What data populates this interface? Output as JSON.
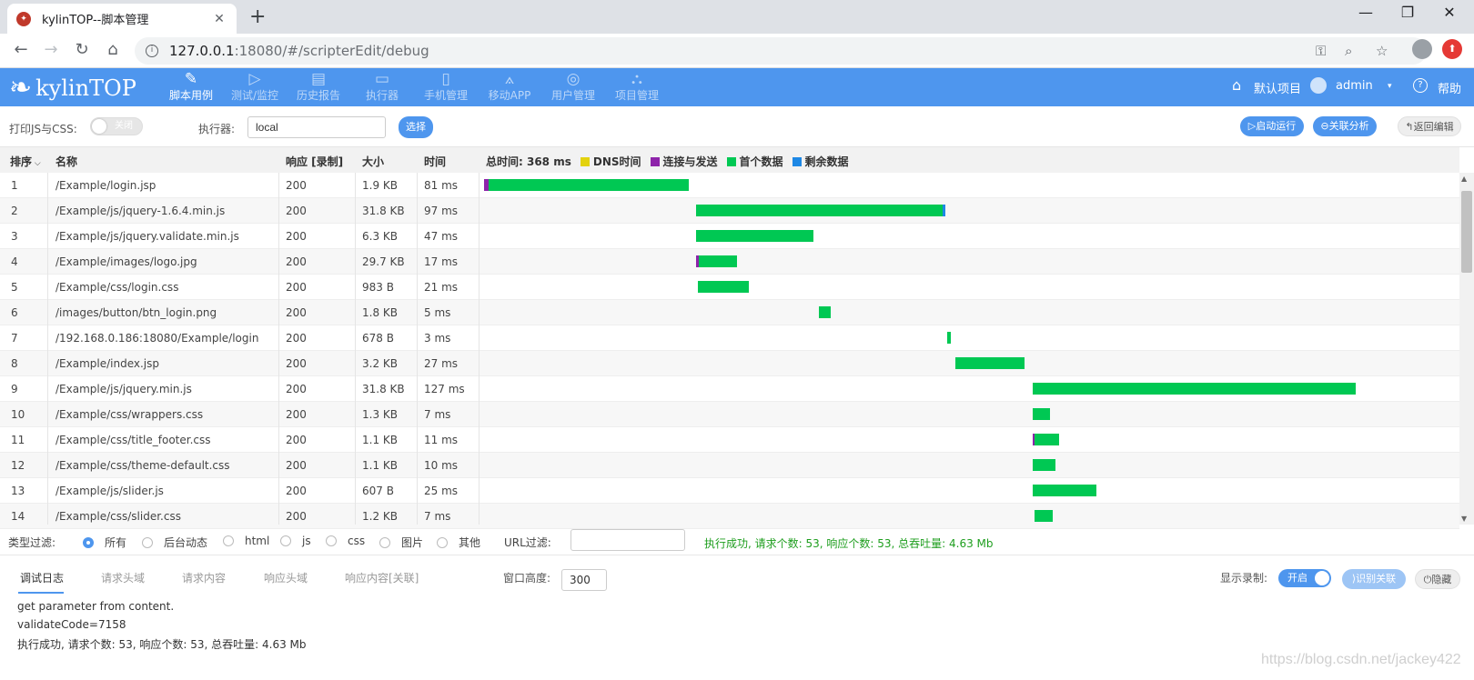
{
  "browser": {
    "tab_title": "kylinTOP--脚本管理",
    "url_host": "127.0.0.1",
    "url_path": ":18080/#/scripterEdit/debug"
  },
  "header": {
    "logo_text": "kylinTOP",
    "nav": [
      {
        "label": "脚本用例",
        "icon": "pencil-icon",
        "active": true
      },
      {
        "label": "测试/监控",
        "icon": "play-icon",
        "active": false
      },
      {
        "label": "历史报告",
        "icon": "report-icon",
        "active": false
      },
      {
        "label": "执行器",
        "icon": "monitor-icon",
        "active": false
      },
      {
        "label": "手机管理",
        "icon": "phone-icon",
        "active": false
      },
      {
        "label": "移动APP",
        "icon": "app-icon",
        "active": false
      },
      {
        "label": "用户管理",
        "icon": "user-icon",
        "active": false
      },
      {
        "label": "项目管理",
        "icon": "project-icon",
        "active": false
      }
    ],
    "project": "默认项目",
    "user": "admin",
    "help": "帮助"
  },
  "toolbar": {
    "print_label": "打印JS与CSS:",
    "print_toggle": "关闭",
    "executor_label": "执行器:",
    "executor_value": "local",
    "select_btn": "选择",
    "run_btn": "启动运行",
    "analyze_btn": "关联分析",
    "back_btn": "返回编辑"
  },
  "table": {
    "headers": {
      "order": "排序",
      "name": "名称",
      "response": "响应 [录制]",
      "size": "大小",
      "time": "时间"
    },
    "total_time": "总时间:  368 ms",
    "legend": [
      {
        "label": "DNS时间",
        "color": "#e3d20e"
      },
      {
        "label": "连接与发送",
        "color": "#8e24aa"
      },
      {
        "label": "首个数据",
        "color": "#00c853"
      },
      {
        "label": "剩余数据",
        "color": "#1e88e5"
      }
    ],
    "rows": [
      {
        "n": "1",
        "name": "/Example/login.jsp",
        "resp": "200",
        "size": "1.9 KB",
        "time": "81 ms"
      },
      {
        "n": "2",
        "name": "/Example/js/jquery-1.6.4.min.js",
        "resp": "200",
        "size": "31.8 KB",
        "time": "97 ms"
      },
      {
        "n": "3",
        "name": "/Example/js/jquery.validate.min.js",
        "resp": "200",
        "size": "6.3 KB",
        "time": "47 ms"
      },
      {
        "n": "4",
        "name": "/Example/images/logo.jpg",
        "resp": "200",
        "size": "29.7 KB",
        "time": "17 ms"
      },
      {
        "n": "5",
        "name": "/Example/css/login.css",
        "resp": "200",
        "size": "983 B",
        "time": "21 ms"
      },
      {
        "n": "6",
        "name": "/images/button/btn_login.png",
        "resp": "200",
        "size": "1.8 KB",
        "time": "5 ms"
      },
      {
        "n": "7",
        "name": "/192.168.0.186:18080/Example/login",
        "resp": "200",
        "size": "678 B",
        "time": "3 ms"
      },
      {
        "n": "8",
        "name": "/Example/index.jsp",
        "resp": "200",
        "size": "3.2 KB",
        "time": "27 ms"
      },
      {
        "n": "9",
        "name": "/Example/js/jquery.min.js",
        "resp": "200",
        "size": "31.8 KB",
        "time": "127 ms"
      },
      {
        "n": "10",
        "name": "/Example/css/wrappers.css",
        "resp": "200",
        "size": "1.3 KB",
        "time": "7 ms"
      },
      {
        "n": "11",
        "name": "/Example/css/title_footer.css",
        "resp": "200",
        "size": "1.1 KB",
        "time": "11 ms"
      },
      {
        "n": "12",
        "name": "/Example/css/theme-default.css",
        "resp": "200",
        "size": "1.1 KB",
        "time": "10 ms"
      },
      {
        "n": "13",
        "name": "/Example/js/slider.js",
        "resp": "200",
        "size": "607 B",
        "time": "25 ms"
      },
      {
        "n": "14",
        "name": "/Example/css/slider.css",
        "resp": "200",
        "size": "1.2 KB",
        "time": "7 ms"
      }
    ]
  },
  "filter": {
    "type_label": "类型过滤:",
    "types": [
      "所有",
      "后台动态",
      "html",
      "js",
      "css",
      "图片",
      "其他"
    ],
    "selected": "所有",
    "url_label": "URL过滤:",
    "status": "执行成功, 请求个数: 53, 响应个数: 53, 总吞吐量: 4.63 Mb"
  },
  "bottom": {
    "tabs": [
      "调试日志",
      "请求头域",
      "请求内容",
      "响应头域",
      "响应内容[关联]"
    ],
    "window_height_label": "窗口高度:",
    "window_height": "300",
    "show_record_label": "显示录制:",
    "show_record_toggle": "开启",
    "identify_btn": "识别关联",
    "hide_btn": "隐藏",
    "log": [
      "get parameter from content.",
      "validateCode=7158",
      "执行成功, 请求个数: 53, 响应个数: 53, 总吞吐量: 4.63 Mb"
    ],
    "watermark": "https://blog.csdn.net/jackey422"
  }
}
